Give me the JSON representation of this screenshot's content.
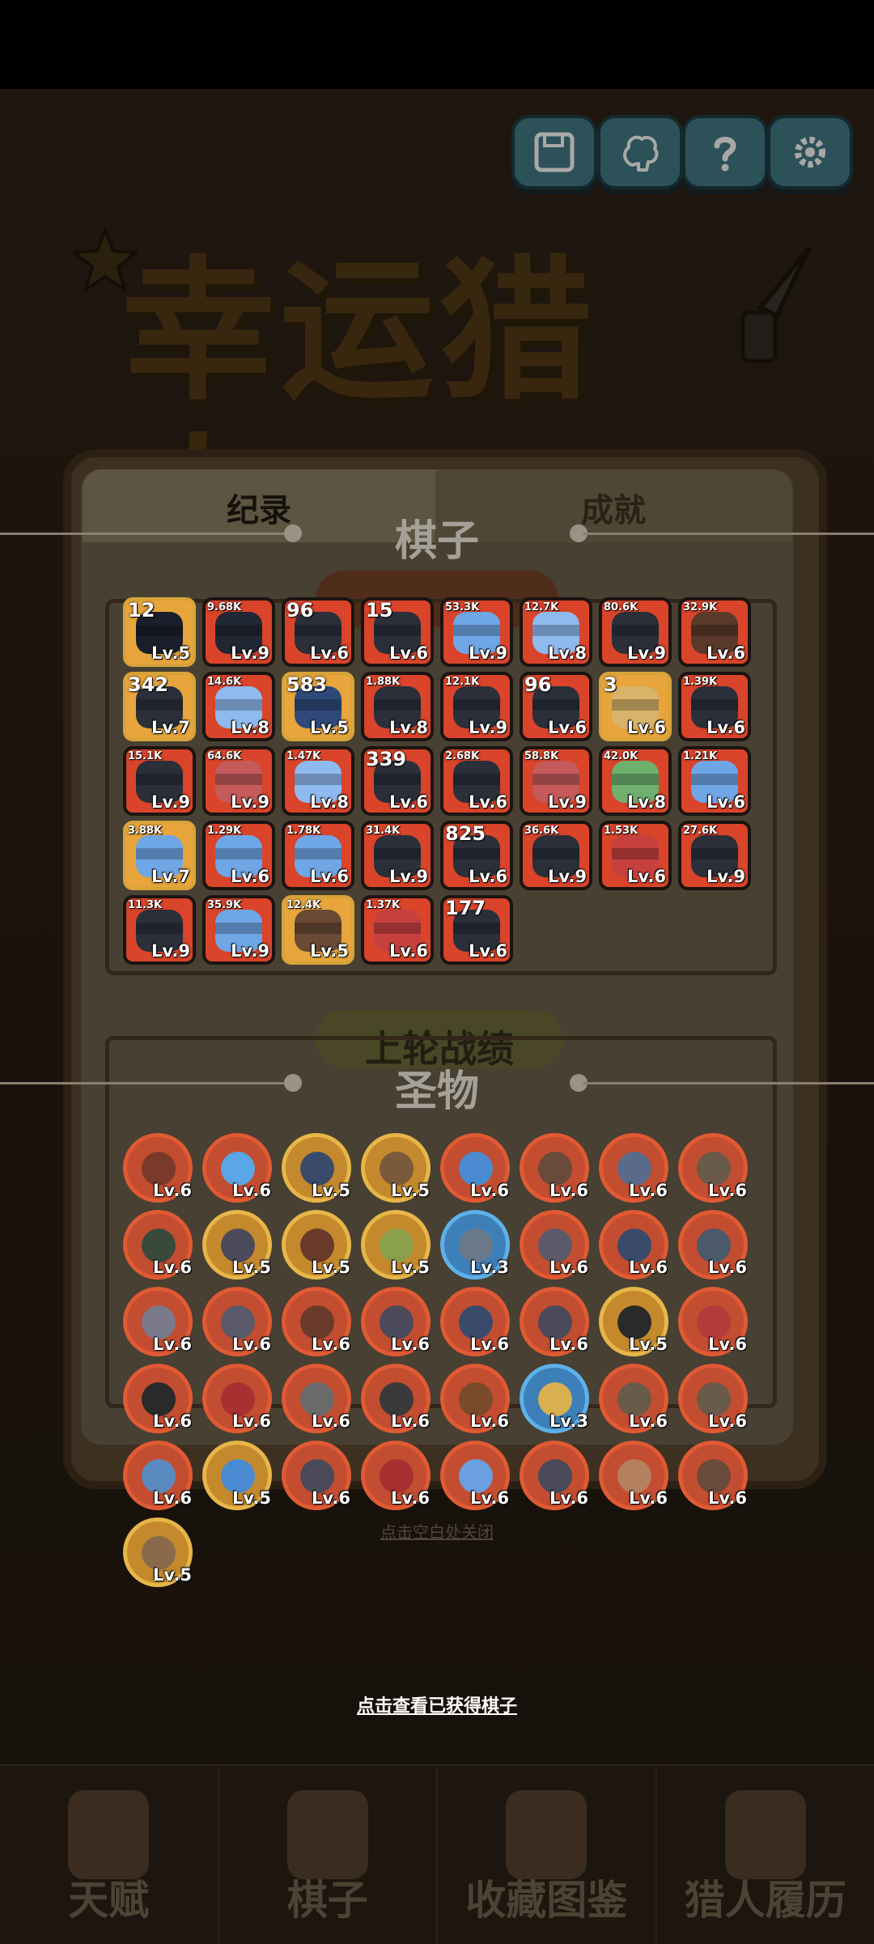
{
  "top_buttons": [
    {
      "name": "save-button",
      "icon": "save-icon"
    },
    {
      "name": "brain-button",
      "icon": "brain-icon"
    },
    {
      "name": "help-button",
      "icon": "question-icon"
    },
    {
      "name": "settings-button",
      "icon": "gear-icon"
    }
  ],
  "game_title": "幸运猎人",
  "background_panel": {
    "tab_left": "纪录",
    "tab_right": "成就",
    "last_round_label": "上轮战绩",
    "close_hint": "点击空白处关闭"
  },
  "pieces_section": {
    "title": "棋子",
    "pieces": [
      {
        "count": "12",
        "level": "Lv.5",
        "color": "#e7a53c",
        "body": "#1a1f2b",
        "small": false
      },
      {
        "count": "9.68K",
        "level": "Lv.9",
        "color": "#d9442a",
        "body": "#222833",
        "small": true
      },
      {
        "count": "96",
        "level": "Lv.6",
        "color": "#d9442a",
        "body": "#2a2f3a",
        "small": false
      },
      {
        "count": "15",
        "level": "Lv.6",
        "color": "#d9442a",
        "body": "#2a2f3a",
        "small": false
      },
      {
        "count": "53.3K",
        "level": "Lv.9",
        "color": "#d9442a",
        "body": "#6fa6e6",
        "small": true
      },
      {
        "count": "12.7K",
        "level": "Lv.8",
        "color": "#d9442a",
        "body": "#8fbaf0",
        "small": true
      },
      {
        "count": "80.6K",
        "level": "Lv.9",
        "color": "#d9442a",
        "body": "#2a2f3a",
        "small": true
      },
      {
        "count": "32.9K",
        "level": "Lv.6",
        "color": "#d9442a",
        "body": "#5a3a2a",
        "small": true
      },
      {
        "count": "342",
        "level": "Lv.7",
        "color": "#e7a53c",
        "body": "#2a2f3a",
        "small": false
      },
      {
        "count": "14.6K",
        "level": "Lv.8",
        "color": "#d9442a",
        "body": "#8fbaf0",
        "small": true
      },
      {
        "count": "583",
        "level": "Lv.5",
        "color": "#e7a53c",
        "body": "#2f4a7a",
        "small": false
      },
      {
        "count": "1.88K",
        "level": "Lv.8",
        "color": "#d9442a",
        "body": "#2a2f3a",
        "small": true
      },
      {
        "count": "12.1K",
        "level": "Lv.9",
        "color": "#d9442a",
        "body": "#2a2f3a",
        "small": true
      },
      {
        "count": "96",
        "level": "Lv.6",
        "color": "#d9442a",
        "body": "#2a2f3a",
        "small": false
      },
      {
        "count": "3",
        "level": "Lv.6",
        "color": "#e7a53c",
        "body": "#d8b36a",
        "small": false
      },
      {
        "count": "1.39K",
        "level": "Lv.6",
        "color": "#d9442a",
        "body": "#2a2f3a",
        "small": true
      },
      {
        "count": "15.1K",
        "level": "Lv.9",
        "color": "#d9442a",
        "body": "#2a2f3a",
        "small": true
      },
      {
        "count": "64.6K",
        "level": "Lv.9",
        "color": "#d9442a",
        "body": "#c55a5a",
        "small": true
      },
      {
        "count": "1.47K",
        "level": "Lv.8",
        "color": "#d9442a",
        "body": "#8fbaf0",
        "small": true
      },
      {
        "count": "339",
        "level": "Lv.6",
        "color": "#d9442a",
        "body": "#2a2f3a",
        "small": false
      },
      {
        "count": "2.68K",
        "level": "Lv.6",
        "color": "#d9442a",
        "body": "#2a2f3a",
        "small": true
      },
      {
        "count": "58.8K",
        "level": "Lv.9",
        "color": "#d9442a",
        "body": "#c55a5a",
        "small": true
      },
      {
        "count": "42.0K",
        "level": "Lv.8",
        "color": "#d9442a",
        "body": "#6fb06f",
        "small": true
      },
      {
        "count": "1.21K",
        "level": "Lv.6",
        "color": "#d9442a",
        "body": "#6fa6e6",
        "small": true
      },
      {
        "count": "3.88K",
        "level": "Lv.7",
        "color": "#e7a53c",
        "body": "#6fa6e6",
        "small": true
      },
      {
        "count": "1.29K",
        "level": "Lv.6",
        "color": "#d9442a",
        "body": "#6fa6e6",
        "small": true
      },
      {
        "count": "1.78K",
        "level": "Lv.6",
        "color": "#d9442a",
        "body": "#6fa6e6",
        "small": true
      },
      {
        "count": "31.4K",
        "level": "Lv.9",
        "color": "#d9442a",
        "body": "#2a2f3a",
        "small": true
      },
      {
        "count": "825",
        "level": "Lv.6",
        "color": "#d9442a",
        "body": "#2a2f3a",
        "small": false
      },
      {
        "count": "36.6K",
        "level": "Lv.9",
        "color": "#d9442a",
        "body": "#2a2f3a",
        "small": true
      },
      {
        "count": "1.53K",
        "level": "Lv.6",
        "color": "#d9442a",
        "body": "#c74040",
        "small": true
      },
      {
        "count": "27.6K",
        "level": "Lv.9",
        "color": "#d9442a",
        "body": "#2a2f3a",
        "small": true
      },
      {
        "count": "11.3K",
        "level": "Lv.9",
        "color": "#d9442a",
        "body": "#2a2f3a",
        "small": true
      },
      {
        "count": "35.9K",
        "level": "Lv.9",
        "color": "#d9442a",
        "body": "#6fa6e6",
        "small": true
      },
      {
        "count": "12.4K",
        "level": "Lv.5",
        "color": "#e7a53c",
        "body": "#6a4a35",
        "small": true
      },
      {
        "count": "1.37K",
        "level": "Lv.6",
        "color": "#d9442a",
        "body": "#c74040",
        "small": true
      },
      {
        "count": "177",
        "level": "Lv.6",
        "color": "#d9442a",
        "body": "#2a2f3a",
        "small": false
      }
    ]
  },
  "relics_section": {
    "title": "圣物",
    "relics": [
      {
        "level": "Lv.6",
        "ring": "red",
        "face": "#7a3a2a"
      },
      {
        "level": "Lv.6",
        "ring": "red",
        "face": "#5aa6e6"
      },
      {
        "level": "Lv.5",
        "ring": "gold",
        "face": "#3a4a6a"
      },
      {
        "level": "Lv.5",
        "ring": "gold",
        "face": "#7a5a3a"
      },
      {
        "level": "Lv.6",
        "ring": "red",
        "face": "#4a8ad0"
      },
      {
        "level": "Lv.6",
        "ring": "red",
        "face": "#6a4a3a"
      },
      {
        "level": "Lv.6",
        "ring": "red",
        "face": "#5a6a8a"
      },
      {
        "level": "Lv.6",
        "ring": "red",
        "face": "#6a5a4a"
      },
      {
        "level": "Lv.6",
        "ring": "red",
        "face": "#3a4a3a"
      },
      {
        "level": "Lv.5",
        "ring": "gold",
        "face": "#4a4a5a"
      },
      {
        "level": "Lv.5",
        "ring": "gold",
        "face": "#6a3a2a"
      },
      {
        "level": "Lv.5",
        "ring": "gold",
        "face": "#8aa04a"
      },
      {
        "level": "Lv.3",
        "ring": "blue",
        "face": "#6a7a8a"
      },
      {
        "level": "Lv.6",
        "ring": "red",
        "face": "#5a5a6a"
      },
      {
        "level": "Lv.6",
        "ring": "red",
        "face": "#3a4a6a"
      },
      {
        "level": "Lv.6",
        "ring": "red",
        "face": "#4a5a6a"
      },
      {
        "level": "Lv.6",
        "ring": "red",
        "face": "#7a7a8a"
      },
      {
        "level": "Lv.6",
        "ring": "red",
        "face": "#5a5a6a"
      },
      {
        "level": "Lv.6",
        "ring": "red",
        "face": "#6a3a2a"
      },
      {
        "level": "Lv.6",
        "ring": "red",
        "face": "#4a4a5a"
      },
      {
        "level": "Lv.6",
        "ring": "red",
        "face": "#3a4a6a"
      },
      {
        "level": "Lv.6",
        "ring": "red",
        "face": "#4a4a5a"
      },
      {
        "level": "Lv.5",
        "ring": "gold",
        "face": "#2a2a2a"
      },
      {
        "level": "Lv.6",
        "ring": "red",
        "face": "#b53a3a"
      },
      {
        "level": "Lv.6",
        "ring": "red",
        "face": "#2a2a2a"
      },
      {
        "level": "Lv.6",
        "ring": "red",
        "face": "#a83030"
      },
      {
        "level": "Lv.6",
        "ring": "red",
        "face": "#6a6a6a"
      },
      {
        "level": "Lv.6",
        "ring": "red",
        "face": "#3a3a3a"
      },
      {
        "level": "Lv.6",
        "ring": "red",
        "face": "#7a4a2a"
      },
      {
        "level": "Lv.3",
        "ring": "blue",
        "face": "#d8b050"
      },
      {
        "level": "Lv.6",
        "ring": "red",
        "face": "#6a5a4a"
      },
      {
        "level": "Lv.6",
        "ring": "red",
        "face": "#6a5a4a"
      },
      {
        "level": "Lv.6",
        "ring": "red",
        "face": "#5a8ac0"
      },
      {
        "level": "Lv.5",
        "ring": "gold",
        "face": "#4a8ad0"
      },
      {
        "level": "Lv.6",
        "ring": "red",
        "face": "#4a4a5a"
      },
      {
        "level": "Lv.6",
        "ring": "red",
        "face": "#a83030"
      },
      {
        "level": "Lv.6",
        "ring": "red",
        "face": "#6aa0e0"
      },
      {
        "level": "Lv.6",
        "ring": "red",
        "face": "#4a4a5a"
      },
      {
        "level": "Lv.6",
        "ring": "red",
        "face": "#b58060"
      },
      {
        "level": "Lv.6",
        "ring": "red",
        "face": "#6a4a3a"
      },
      {
        "level": "Lv.5",
        "ring": "gold",
        "face": "#8a6a4a"
      }
    ]
  },
  "view_obtained_link": "点击查看已获得棋子",
  "bottom_nav": [
    {
      "label": "天赋"
    },
    {
      "label": "棋子"
    },
    {
      "label": "收藏图鉴"
    },
    {
      "label": "猎人履历"
    }
  ]
}
